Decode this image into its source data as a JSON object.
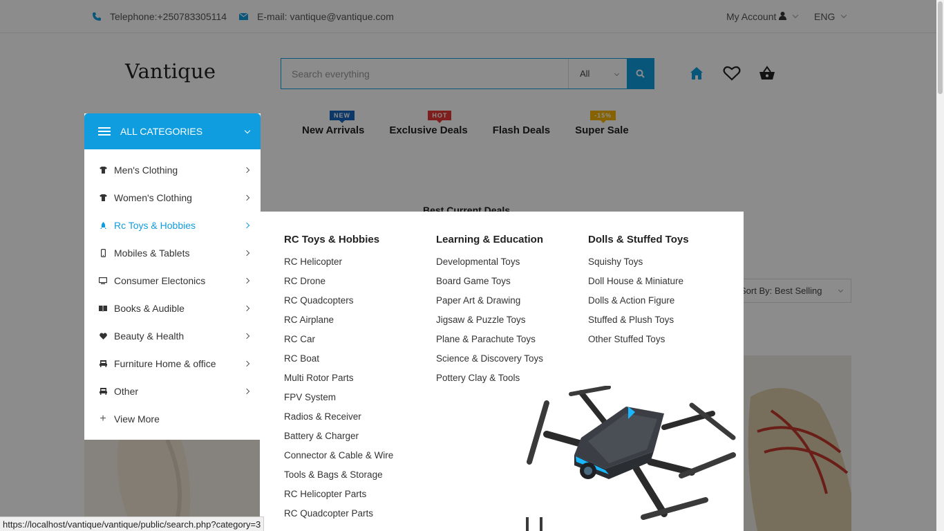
{
  "topbar": {
    "telephone": "Telephone:+250783305114",
    "email": "E-mail: vantique@vantique.com",
    "account": "My Account",
    "language": "ENG"
  },
  "header": {
    "logo": "Vantique",
    "search_placeholder": "Search everything",
    "search_category": "All",
    "icons": [
      "home-icon",
      "heart-icon",
      "basket-icon"
    ]
  },
  "nav": {
    "links": [
      {
        "label": "New Arrivals",
        "badge": "NEW",
        "badge_color": "#1565c0"
      },
      {
        "label": "Exclusive Deals",
        "badge": "HOT",
        "badge_color": "#e53935"
      },
      {
        "label": "Flash Deals",
        "badge": "",
        "badge_color": ""
      },
      {
        "label": "Super Sale",
        "badge": "-15%",
        "badge_color": "#f4b400"
      }
    ]
  },
  "content": {
    "section_title": "Best Current Deals",
    "sort_label": "Sort By: Best Selling"
  },
  "categories": {
    "header": "ALL CATEGORIES",
    "items": [
      {
        "label": "Men's Clothing",
        "icon": "shirt-icon"
      },
      {
        "label": "Women's Clothing",
        "icon": "shirt-icon"
      },
      {
        "label": "Rc Toys & Hobbies",
        "icon": "rocket-icon",
        "active": true
      },
      {
        "label": "Mobiles & Tablets",
        "icon": "mobile-icon"
      },
      {
        "label": "Consumer Electonics",
        "icon": "desktop-icon"
      },
      {
        "label": "Books & Audible",
        "icon": "book-icon"
      },
      {
        "label": "Beauty & Health",
        "icon": "heart-icon"
      },
      {
        "label": "Furniture Home & office",
        "icon": "furniture-icon"
      },
      {
        "label": "Other",
        "icon": "furniture-icon"
      }
    ],
    "view_more": "View More"
  },
  "mega": {
    "columns": [
      {
        "title": "RC Toys & Hobbies",
        "items": [
          "RC Helicopter",
          "RC Drone",
          "RC Quadcopters",
          "RC Airplane",
          "RC Car",
          "RC Boat",
          "Multi Rotor Parts",
          "FPV System",
          "Radios & Receiver",
          "Battery & Charger",
          "Connector & Cable & Wire",
          "Tools & Bags & Storage",
          "RC Helicopter Parts",
          "RC Quadcopter Parts"
        ]
      },
      {
        "title": "Learning & Education",
        "items": [
          "Developmental Toys",
          "Board Game Toys",
          "Paper Art & Drawing",
          "Jigsaw & Puzzle Toys",
          "Plane & Parachute Toys",
          "Science & Discovery Toys",
          "Pottery Clay & Tools"
        ]
      },
      {
        "title": "Dolls & Stuffed Toys",
        "items": [
          "Squishy Toys",
          "Doll House & Miniature",
          "Dolls & Action Figure",
          "Stuffed & Plush Toys",
          "Other Stuffed Toys"
        ]
      }
    ],
    "promo_image": "drone-image"
  },
  "statusbar": {
    "url": "https://localhost/vantique/vantique/public/search.php?category=3"
  },
  "colors": {
    "accent": "#0f9ddf"
  }
}
